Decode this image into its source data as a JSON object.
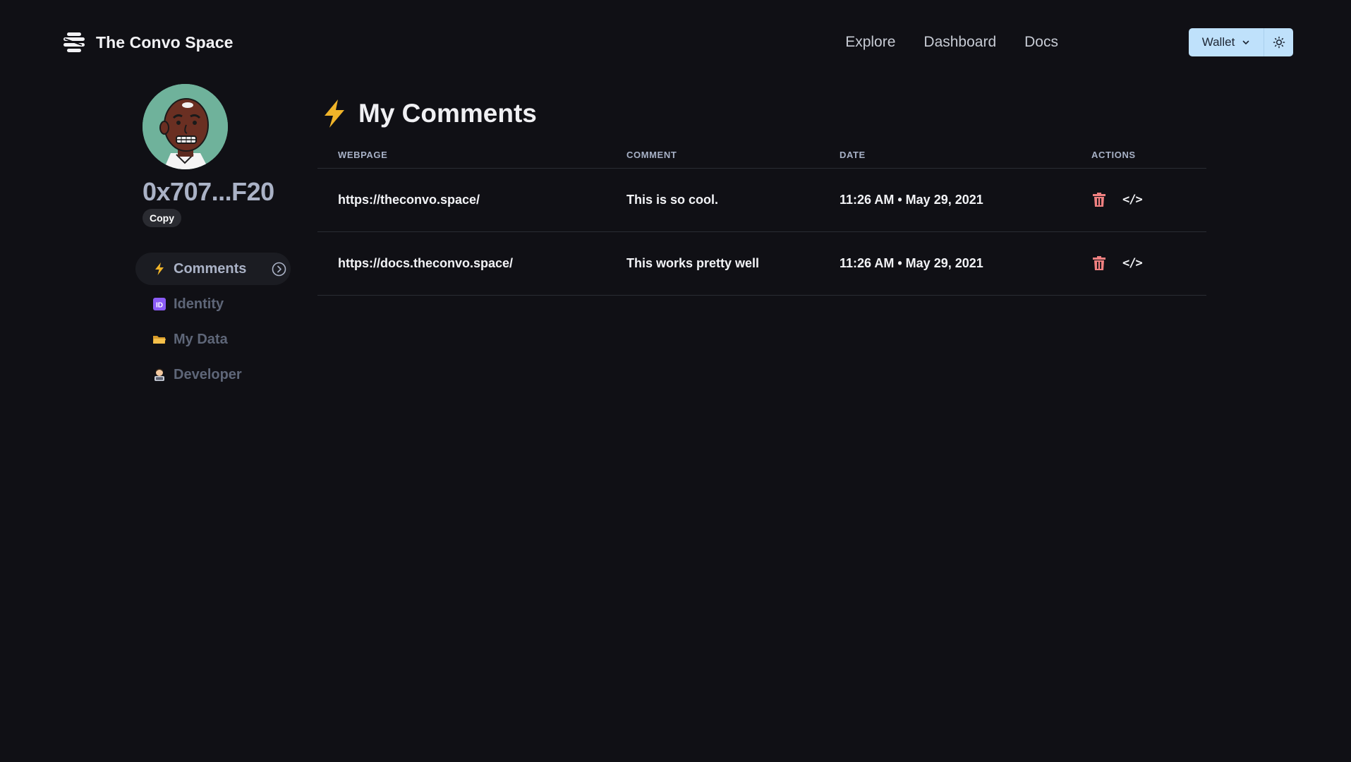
{
  "header": {
    "brand_name": "The Convo Space",
    "nav": [
      "Explore",
      "Dashboard",
      "Docs"
    ],
    "wallet_label": "Wallet"
  },
  "sidebar": {
    "address": "0x707...F20",
    "copy_label": "Copy",
    "items": [
      {
        "label": "Comments",
        "icon": "lightning-icon",
        "active": true
      },
      {
        "label": "Identity",
        "icon": "id-badge-icon",
        "active": false
      },
      {
        "label": "My Data",
        "icon": "folder-icon",
        "active": false
      },
      {
        "label": "Developer",
        "icon": "developer-icon",
        "active": false
      }
    ]
  },
  "main": {
    "title": "My Comments",
    "columns": [
      "WEBPAGE",
      "COMMENT",
      "DATE",
      "ACTIONS"
    ],
    "rows": [
      {
        "webpage": "https://theconvo.space/",
        "comment": "This is so cool.",
        "date": "11:26 AM • May 29, 2021"
      },
      {
        "webpage": "https://docs.theconvo.space/",
        "comment": "This works pretty well",
        "date": "11:26 AM • May 29, 2021"
      }
    ],
    "embed_label": "</>"
  },
  "colors": {
    "background": "#101015",
    "wallet_button": "#bfe1fb",
    "delete_icon": "#f08080",
    "lightning": "#f0b429",
    "muted_text": "#5e6678",
    "accent_text": "#aab2c6"
  }
}
